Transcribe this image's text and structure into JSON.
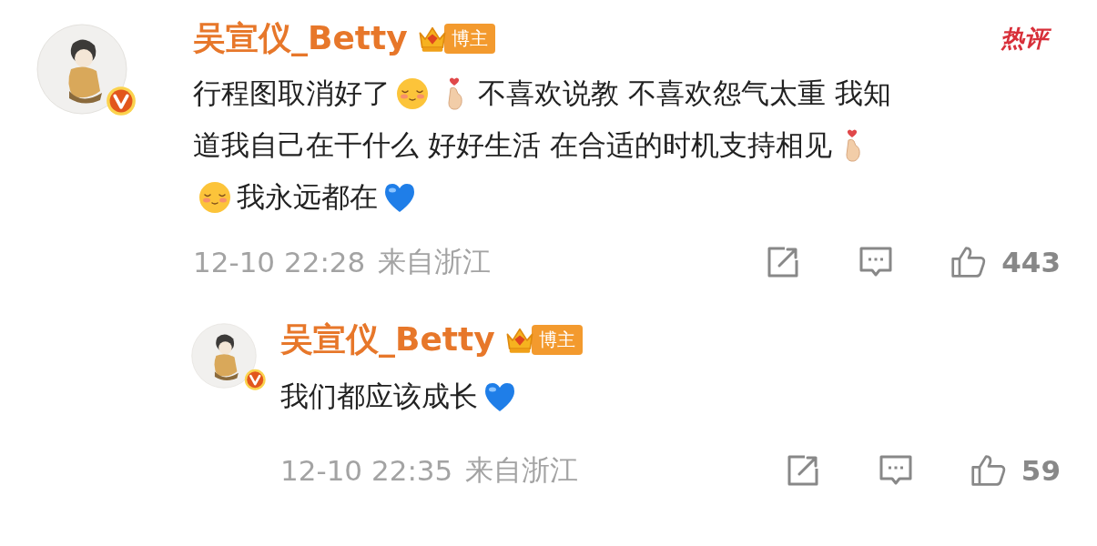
{
  "comments": [
    {
      "kind": "comment",
      "author": "吴宣仪_Betty",
      "badge": "博主",
      "verified": true,
      "hot_tag": "热评",
      "lines": [
        [
          {
            "kind": "text",
            "text": "行程图取消好了"
          },
          {
            "kind": "blush"
          },
          {
            "kind": "finger-heart"
          },
          {
            "kind": "text",
            "text": "不喜欢说教 不喜欢怨气太重 我知"
          }
        ],
        [
          {
            "kind": "text",
            "text": "道我自己在干什么 好好生活 在合适的时机支持相见"
          },
          {
            "kind": "finger-heart"
          }
        ],
        [
          {
            "kind": "blush"
          },
          {
            "kind": "text",
            "text": "我永远都在"
          },
          {
            "kind": "blue-heart"
          }
        ]
      ],
      "time": "12-10 22:28",
      "location": "来自浙江",
      "likes": "443"
    },
    {
      "kind": "reply",
      "author": "吴宣仪_Betty",
      "badge": "博主",
      "verified": true,
      "lines": [
        [
          {
            "kind": "text",
            "text": "我们都应该成长"
          },
          {
            "kind": "blue-heart"
          }
        ]
      ],
      "time": "12-10 22:35",
      "location": "来自浙江",
      "likes": "59"
    }
  ]
}
